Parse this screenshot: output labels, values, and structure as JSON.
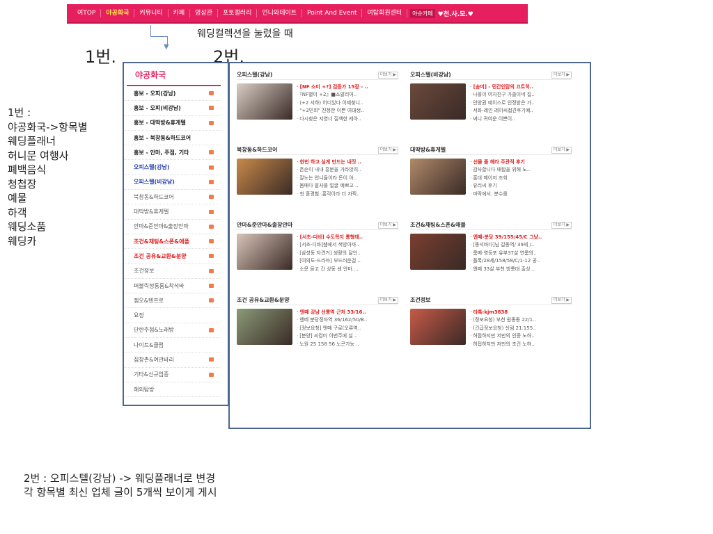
{
  "topnav": {
    "items": [
      "여TOP",
      "야공화국",
      "커뮤니티",
      "카페",
      "영상관",
      "포토갤러리",
      "언니와데이트",
      "Point And Event",
      "여탑회원센터"
    ],
    "cafe_badge": "야슈카페",
    "club": "♥천.사.모.♥"
  },
  "annotations": {
    "top_note": "웨딩컬렉션을 눌렀을 때",
    "label_1": "1번.",
    "label_2": "2번.",
    "side_note": [
      "1번 :",
      "야공화국->항목별",
      "웨딩플래너",
      "허니문 여행사",
      "폐백음식",
      "청첩장",
      "예물",
      "하객",
      "웨딩소품",
      "웨딩카"
    ],
    "bottom_note": [
      "2번 : 오피스텔(강남) -> 웨딩플래너로 변경",
      "각 항목별 최신 업체 글이 5개씩 보이게 게시"
    ]
  },
  "sidebar": {
    "title": "야공화국",
    "items": [
      {
        "label": "홍보 - 오피(강남)",
        "style": "bold",
        "icon": true
      },
      {
        "label": "홍보 - 오피(비강남)",
        "style": "bold",
        "icon": true
      },
      {
        "label": "홍보 - 대딱방&휴게텔",
        "style": "bold",
        "icon": true
      },
      {
        "label": "홍보 - 북창동&하드코어",
        "style": "bold",
        "icon": false
      },
      {
        "label": "홍보 - 안마, 주점, 기타",
        "style": "bold",
        "icon": true
      },
      {
        "label": "오피스텔(강남)",
        "style": "blue",
        "icon": true
      },
      {
        "label": "오피스텔(비강남)",
        "style": "blue",
        "icon": true
      },
      {
        "label": "북창동&하드코어",
        "style": "normal",
        "icon": true
      },
      {
        "label": "대딱방&휴게텔",
        "style": "normal",
        "icon": true
      },
      {
        "label": "안마&준안마&출장안마",
        "style": "normal",
        "icon": true
      },
      {
        "label": "조건&채팅&스폰&애플",
        "style": "red",
        "icon": true
      },
      {
        "label": "조건 공유&교환&분양",
        "style": "red",
        "icon": true
      },
      {
        "label": "조건정보",
        "style": "normal",
        "icon": true
      },
      {
        "label": "퍼블릭정통룸&착석바",
        "style": "normal",
        "icon": true
      },
      {
        "label": "젬오&텐프로",
        "style": "normal",
        "icon": true
      },
      {
        "label": "요정",
        "style": "normal",
        "icon": false
      },
      {
        "label": "단란주점&노래방",
        "style": "normal",
        "icon": true
      },
      {
        "label": "나이트&클럽",
        "style": "normal",
        "icon": false
      },
      {
        "label": "집창촌&여관바리",
        "style": "normal",
        "icon": true
      },
      {
        "label": "기타&신규업종",
        "style": "normal",
        "icon": true
      },
      {
        "label": "해외탐방",
        "style": "normal",
        "icon": false
      }
    ]
  },
  "main": {
    "sections": [
      {
        "title": "오피스텔(강남)",
        "more": "더보기 ▶",
        "thumb_color": "#d8cdc4",
        "posts": [
          "[NF 소미 +?] 검증가 15장 - ..",
          "『NF별이 +2』■소말리아..",
          "(+2 서하) 어디있다 이제찾니..",
          "\"+2민희\" 진정한 이쁜 여대생..",
          "다시찾은 지영너 질책한 레아.."
        ]
      },
      {
        "title": "오피스텔(비강남)",
        "more": "더보기 ▶",
        "thumb_color": "#6b4a3c",
        "posts": [
          "[송미] - 민간인맘의 끄트히..",
          "나를이 여자친구 가졸이네 집..",
          "안양권 예이스로 인정받은 가..",
          "서화-레인 레이씨접견후기예..",
          "써니 귀여운 이쁜이.."
        ]
      },
      {
        "title": "북창동&하드코어",
        "more": "더보기 ▶",
        "thumb_color": "#c88a4a",
        "posts": [
          "한번 하고 싶게 만드는 내짓 ..",
          "존순이 내내 흥분을 가라앉히..",
          "잘노는 언니들이라 돈이 아..",
          "몸매다 발사를 얼굴 예쁘고 ..",
          "첫 홀경험..홍각이라 더 자찍.."
        ]
      },
      {
        "title": "대딱방&휴게텔",
        "more": "더보기 ▶",
        "thumb_color": "#b08a6a",
        "posts": [
          "선물 줄 헤라 주관적 후기",
          "감사합니다 애탑을 위해 노..",
          "홍대 메이저 조회",
          "유리씨 후기",
          "마딱에서. 분수를"
        ]
      },
      {
        "title": "안마&준안마&출장안마",
        "more": "더보기 ▶",
        "thumb_color": "#d8c4b8",
        "posts": [
          "[서초-디바] 수도목지 롱형태..",
          "[서초-디바]쌤에서 색방아까..",
          "[삼성동 자견거] 생활의 달인..",
          "[여의도-드라마] 부드러운걸 ..",
          "소문 듣고 간 상동 센 안마...."
        ]
      },
      {
        "title": "조건&채팅&스폰&애플",
        "more": "더보기 ▶",
        "thumb_color": "#7a3f30",
        "posts": [
          "엔떼-분당 39/155/45/C 그냥..",
          "[동넉바다]님 길동역/ 39세 /..",
          "룸메-영등포 유부37살 연룸의..",
          "플록/28세/158/58/C/1-12 공..",
          "엔떼 33살 부천 방통대 출싱 .."
        ]
      },
      {
        "title": "조건 공유&교환&분양",
        "more": "더보기 ▶",
        "thumb_color": "#8a9a78",
        "posts": [
          "엔떼 강남 선릉역 근처 33/16..",
          "엔떼 분당정자역 36/162/50/B..",
          "[정보요청] 엔떼 구로(오류역..",
          "[분양] 씨컴미 이번주에 설 ..",
          "노원 25 158 56 노콘가능 .."
        ]
      },
      {
        "title": "조건정보",
        "more": "더보기 ▶",
        "thumb_color": "#c85a48",
        "posts": [
          "타톡:kjm3838",
          "(정보요청) 부천 원종동 22/1..",
          "(긴급정보요청) 신림 21.155..",
          "허접하지만 저만의 인증 노하..",
          "허접하지만 저만의 조건 노하.."
        ]
      }
    ]
  }
}
